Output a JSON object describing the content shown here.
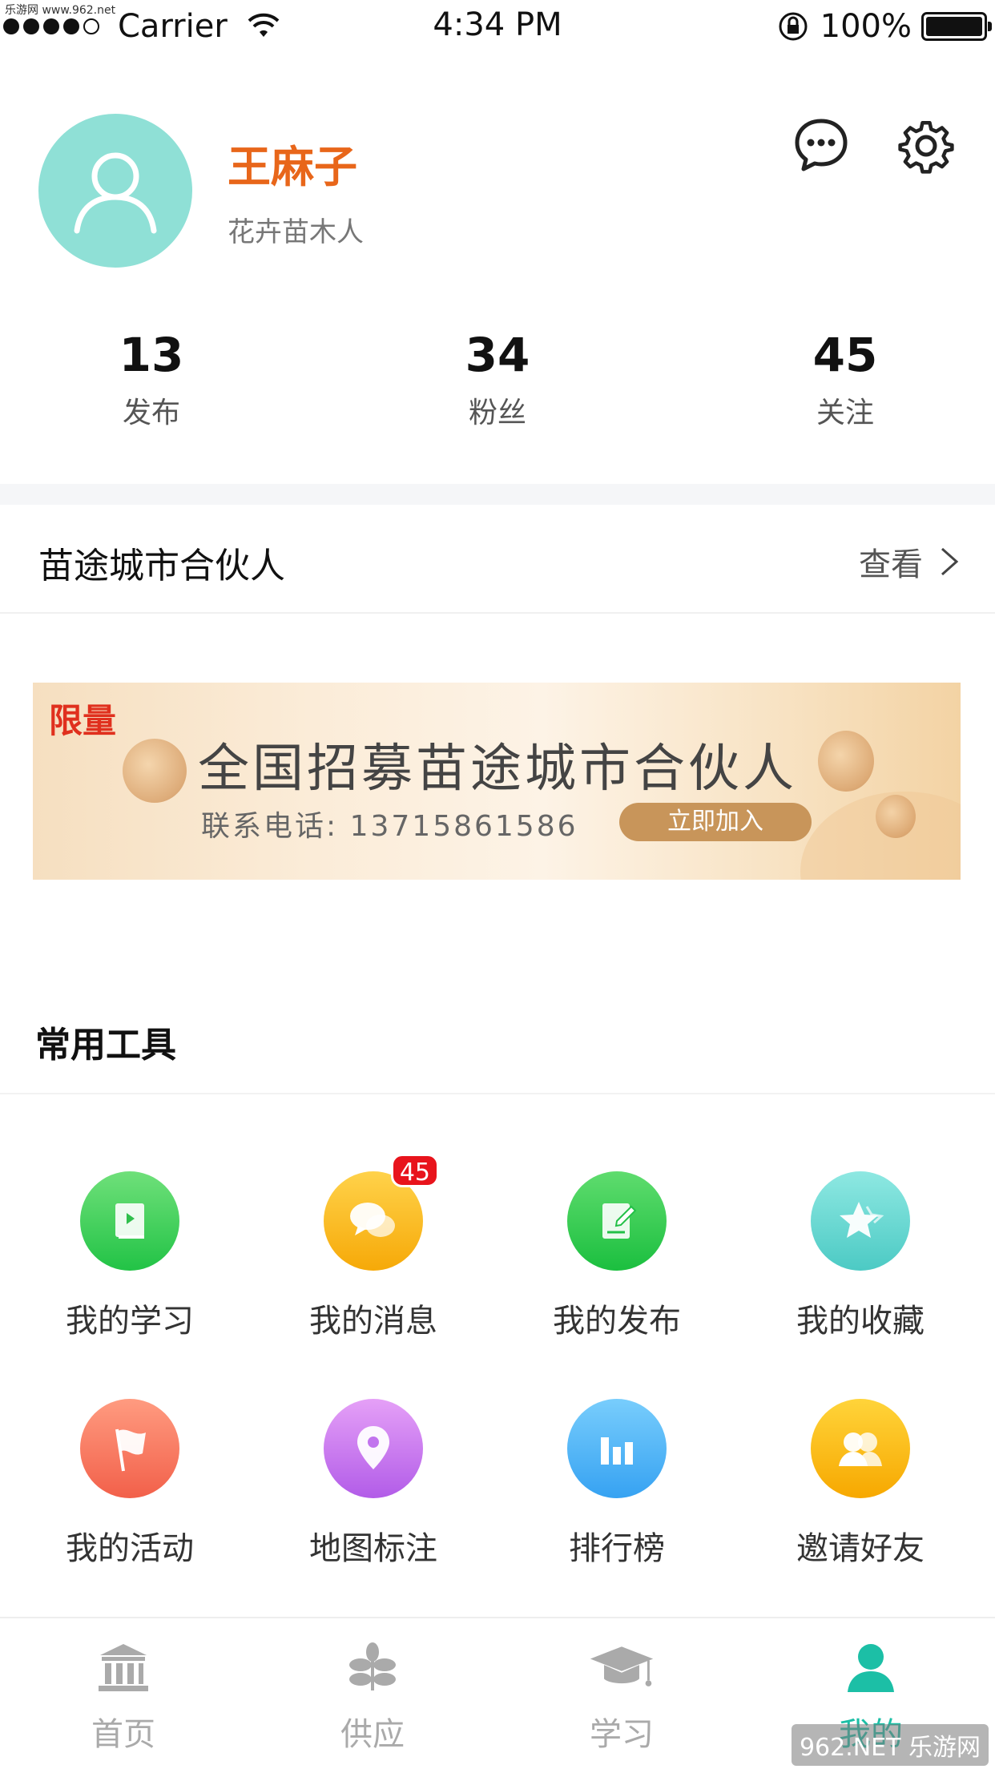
{
  "watermark_top": "乐游网 www.962.net",
  "status_bar": {
    "carrier": "Carrier",
    "time": "4:34 PM",
    "battery": "100%"
  },
  "profile": {
    "name": "王麻子",
    "tag": "花卉苗木人",
    "stats": [
      {
        "value": "13",
        "label": "发布"
      },
      {
        "value": "34",
        "label": "粉丝"
      },
      {
        "value": "45",
        "label": "关注"
      }
    ]
  },
  "partner_section": {
    "title": "苗途城市合伙人",
    "link": "查看"
  },
  "banner": {
    "limit_tag": "限量",
    "title": "全国招募苗途城市合伙人",
    "phone": "联系电话: 13715861586",
    "button": "立即加入"
  },
  "tools": {
    "title": "常用工具",
    "items": [
      {
        "label": "我的学习",
        "icon": "book-icon",
        "color": "#3fcf5a"
      },
      {
        "label": "我的消息",
        "icon": "chat-bubbles-icon",
        "color": "#f7b81d",
        "badge": "45"
      },
      {
        "label": "我的发布",
        "icon": "document-edit-icon",
        "color": "#32c95a"
      },
      {
        "label": "我的收藏",
        "icon": "star-icon",
        "color": "#6fd8d2"
      },
      {
        "label": "我的活动",
        "icon": "flag-icon",
        "color": "#f77c64"
      },
      {
        "label": "地图标注",
        "icon": "location-pin-icon",
        "color": "#c47cf0"
      },
      {
        "label": "排行榜",
        "icon": "bar-chart-icon",
        "color": "#4eb4f6"
      },
      {
        "label": "邀请好友",
        "icon": "friends-icon",
        "color": "#f9b910"
      }
    ]
  },
  "tab_bar": {
    "items": [
      {
        "label": "首页",
        "icon": "bank-icon",
        "active": false
      },
      {
        "label": "供应",
        "icon": "plant-icon",
        "active": false
      },
      {
        "label": "学习",
        "icon": "graduation-cap-icon",
        "active": false
      },
      {
        "label": "我的",
        "icon": "person-icon",
        "active": true
      }
    ],
    "active_color": "#1cbfa6"
  },
  "watermark_bottom": "962.NET 乐游网"
}
